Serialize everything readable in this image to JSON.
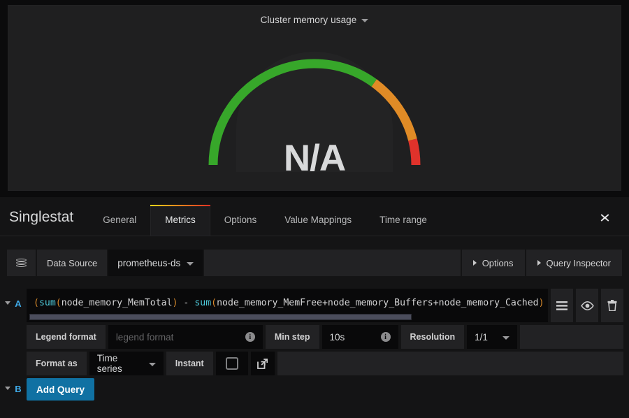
{
  "panel": {
    "title": "Cluster memory usage",
    "title_caret_icon": "chevron-down-icon",
    "value": "N/A",
    "gauge": {
      "thresholds": [
        {
          "from": 0,
          "to": 70,
          "color": "#37a72a"
        },
        {
          "from": 70,
          "to": 92,
          "color": "#e08b26"
        },
        {
          "from": 92,
          "to": 100,
          "color": "#e0322b"
        }
      ]
    }
  },
  "editor": {
    "title": "Singlestat",
    "close_icon": "close-icon",
    "tabs": [
      {
        "label": "General",
        "active": false
      },
      {
        "label": "Metrics",
        "active": true
      },
      {
        "label": "Options",
        "active": false
      },
      {
        "label": "Value Mappings",
        "active": false
      },
      {
        "label": "Time range",
        "active": false
      }
    ]
  },
  "datasource_row": {
    "icon": "database-icon",
    "label": "Data Source",
    "value": "prometheus-ds",
    "dropdown_icon": "chevron-down-icon",
    "options_button": "Options",
    "query_inspector_button": "Query Inspector"
  },
  "queries": [
    {
      "ref_id": "A",
      "collapse_icon": "chevron-down-icon",
      "expression": "(sum(node_memory_MemTotal) - sum(node_memory_MemFree+node_memory_Buffers+node_memory_Cached)",
      "actions": [
        {
          "name": "query-menu-icon",
          "icon": "hamburger-icon"
        },
        {
          "name": "toggle-visibility-icon",
          "icon": "eye-icon"
        },
        {
          "name": "remove-query-icon",
          "icon": "trash-icon"
        }
      ],
      "legend_format": {
        "label": "Legend format",
        "value": "",
        "placeholder": "legend format",
        "info_icon": "info-icon"
      },
      "min_step": {
        "label": "Min step",
        "value": "10s",
        "info_icon": "info-icon"
      },
      "resolution": {
        "label": "Resolution",
        "value": "1/1",
        "dropdown_icon": "chevron-down-icon"
      },
      "format_as": {
        "label": "Format as",
        "value": "Time series",
        "dropdown_icon": "chevron-down-icon"
      },
      "instant": {
        "label": "Instant",
        "checked": false
      },
      "external_link_icon": "external-link-icon"
    }
  ],
  "add_query_row": {
    "ref_id": "B",
    "collapse_icon": "chevron-down-icon",
    "button_label": "Add Query"
  },
  "colors": {
    "accent_blue": "#1071a3",
    "ref_id_blue": "#3fa9e6",
    "tab_gradient_start": "#ebd61a",
    "tab_gradient_end": "#e02f24"
  }
}
